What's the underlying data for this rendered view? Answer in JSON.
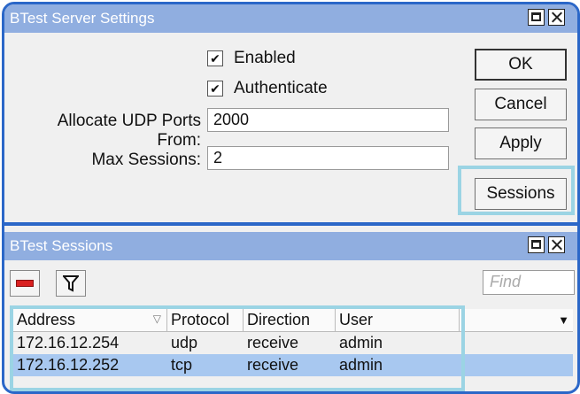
{
  "settings_window": {
    "title": "BTest Server Settings",
    "enabled_label": "Enabled",
    "authenticate_label": "Authenticate",
    "udp_ports_label": "Allocate UDP Ports From:",
    "udp_ports_value": "2000",
    "max_sessions_label": "Max Sessions:",
    "max_sessions_value": "2",
    "buttons": {
      "ok": "OK",
      "cancel": "Cancel",
      "apply": "Apply",
      "sessions": "Sessions"
    }
  },
  "sessions_window": {
    "title": "BTest Sessions",
    "find_placeholder": "Find",
    "columns": [
      "Address",
      "Protocol",
      "Direction",
      "User"
    ],
    "rows": [
      {
        "address": "172.16.12.254",
        "protocol": "udp",
        "direction": "receive",
        "user": "admin"
      },
      {
        "address": "172.16.12.252",
        "protocol": "tcp",
        "direction": "receive",
        "user": "admin"
      }
    ]
  },
  "colors": {
    "titlebar": "#90aee0",
    "frame": "#2b67c8",
    "highlight": "#9bd4e4",
    "selected_row": "#a8c8f0"
  },
  "icons": {
    "remove": "minus-icon",
    "filter": "filter-icon",
    "maximize": "maximize-icon",
    "close": "close-icon"
  }
}
